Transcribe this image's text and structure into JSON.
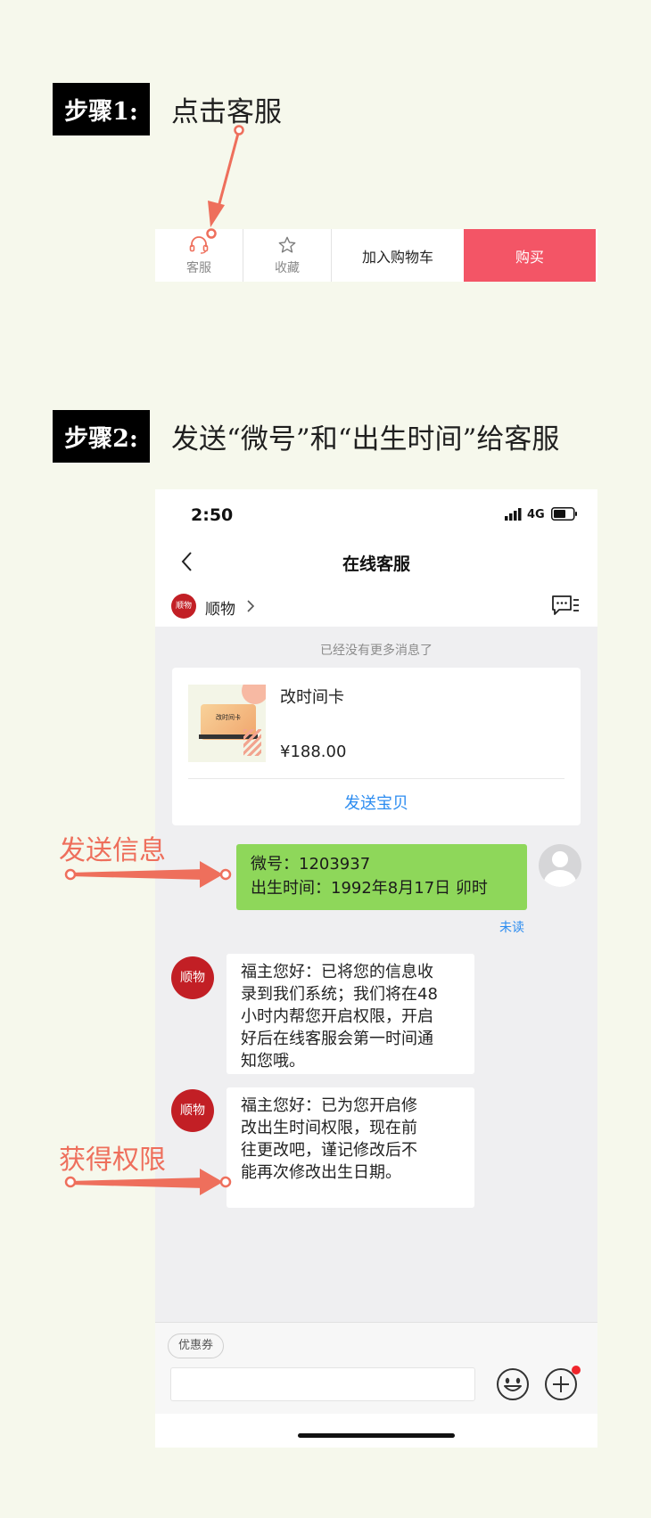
{
  "step1": {
    "badge": "步骤1:",
    "title": "点击客服"
  },
  "action_bar": {
    "service_label": "客服",
    "favorite_label": "收藏",
    "cart_label": "加入购物车",
    "buy_label": "购买"
  },
  "step2": {
    "badge": "步骤2:",
    "title": "发送“微号”和“出生时间”给客服"
  },
  "phone": {
    "status": {
      "time": "2:50",
      "network": "4G"
    },
    "nav": {
      "title": "在线客服"
    },
    "shop": {
      "logo_text": "顺物",
      "name": "顺物"
    },
    "chat": {
      "no_more_notice": "已经没有更多消息了",
      "product": {
        "name": "改时间卡",
        "price": "¥188.00",
        "send_label": "发送宝贝",
        "thumb_text": "改时间卡"
      },
      "user_message": {
        "line1": "微号：1203937",
        "line2": "出生时间：1992年8月17日 卯时",
        "read_status": "未读"
      },
      "reply1": {
        "avatar_text": "顺物",
        "line1": "福主您好：已将您的信息收",
        "line2": "录到我们系统；我们将在48",
        "line3": "小时内帮您开启权限，开启",
        "line4": "好后在线客服会第一时间通",
        "line5": "知您哦。"
      },
      "reply2": {
        "avatar_text": "顺物",
        "line1": "福主您好：已为您开启修",
        "line2": "改出生时间权限，现在前",
        "line3": "往更改吧，谨记修改后不",
        "line4": "能再次修改出生日期。"
      }
    },
    "input": {
      "coupon_label": "优惠券",
      "placeholder": ""
    }
  },
  "annotations": {
    "send_info": "发送信息",
    "get_permission": "获得权限"
  },
  "colors": {
    "page_bg": "#f6f8ec",
    "buy_red": "#f35566",
    "arrow": "#ee6f5c",
    "bubble_green": "#8ed75a",
    "link_blue": "#2c8cf0",
    "shop_red": "#c21f25"
  }
}
